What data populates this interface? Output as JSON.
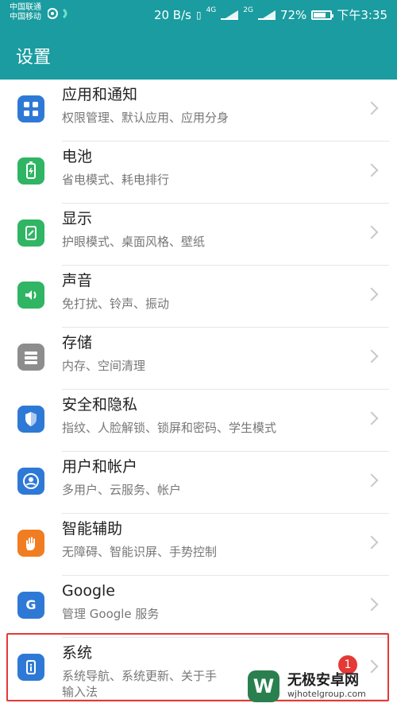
{
  "status": {
    "carrier_1": "中国联通",
    "carrier_2": "中国移动",
    "speed": "20 B/s",
    "net1": "4G",
    "net2": "2G",
    "battery": "72%",
    "battery_level_percent": 72,
    "time": "下午3:35"
  },
  "app": {
    "title": "设置"
  },
  "items": [
    {
      "icon": "apps-grid-icon",
      "color": "#2f79d6",
      "title": "应用和通知",
      "subtitle": "权限管理、默认应用、应用分身"
    },
    {
      "icon": "battery-icon",
      "color": "#2fb563",
      "title": "电池",
      "subtitle": "省电模式、耗电排行"
    },
    {
      "icon": "display-icon",
      "color": "#2fb563",
      "title": "显示",
      "subtitle": "护眼模式、桌面风格、壁纸"
    },
    {
      "icon": "sound-icon",
      "color": "#2fb563",
      "title": "声音",
      "subtitle": "免打扰、铃声、振动"
    },
    {
      "icon": "storage-icon",
      "color": "#8d8d8d",
      "title": "存储",
      "subtitle": "内存、空间清理"
    },
    {
      "icon": "shield-icon",
      "color": "#2f79d6",
      "title": "安全和隐私",
      "subtitle": "指纹、人脸解锁、锁屏和密码、学生模式"
    },
    {
      "icon": "user-icon",
      "color": "#2f79d6",
      "title": "用户和帐户",
      "subtitle": "多用户、云服务、帐户"
    },
    {
      "icon": "hand-icon",
      "color": "#f07d22",
      "title": "智能辅助",
      "subtitle": "无障碍、智能识屏、手势控制"
    },
    {
      "icon": "google-icon",
      "color": "#2f79d6",
      "title": "Google",
      "subtitle": "管理 Google 服务"
    },
    {
      "icon": "system-info-icon",
      "color": "#2f79d6",
      "title": "系统",
      "subtitle": "系统导航、系统更新、关于手",
      "subtitle2": "输入法"
    }
  ],
  "badge": {
    "value": "1"
  },
  "watermark": {
    "title": "无极安卓网",
    "url": "wjhotelgroup.com",
    "logo_letter": "W"
  }
}
